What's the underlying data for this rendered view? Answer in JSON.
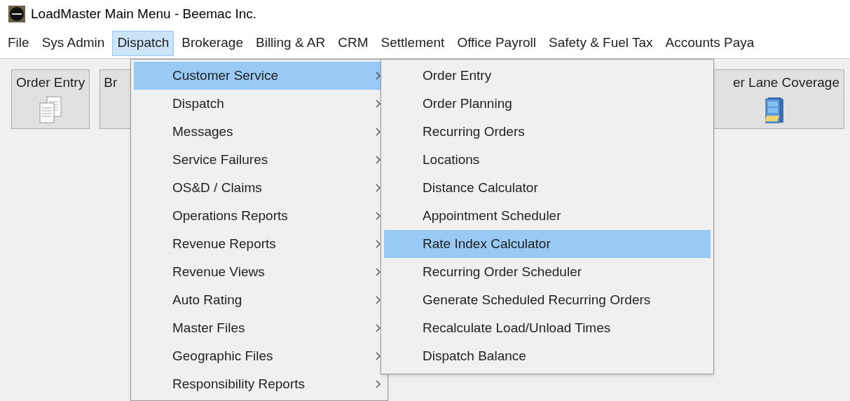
{
  "window": {
    "title": "LoadMaster Main Menu - Beemac Inc."
  },
  "menubar": [
    {
      "label": "File",
      "selected": false
    },
    {
      "label": "Sys Admin",
      "selected": false
    },
    {
      "label": "Dispatch",
      "selected": true
    },
    {
      "label": "Brokerage",
      "selected": false
    },
    {
      "label": "Billing & AR",
      "selected": false
    },
    {
      "label": "CRM",
      "selected": false
    },
    {
      "label": "Settlement",
      "selected": false
    },
    {
      "label": "Office Payroll",
      "selected": false
    },
    {
      "label": "Safety & Fuel Tax",
      "selected": false
    },
    {
      "label": "Accounts Paya",
      "selected": false
    }
  ],
  "toolbar": [
    {
      "label": "Order Entry",
      "kind": "documents"
    },
    {
      "label": "Br",
      "kind": "none"
    },
    {
      "label": "er Lane Coverage",
      "kind": "cabinet"
    }
  ],
  "dispatch_menu": [
    {
      "label": "Customer Service",
      "selected": true
    },
    {
      "label": "Dispatch",
      "selected": false
    },
    {
      "label": "Messages",
      "selected": false
    },
    {
      "label": "Service Failures",
      "selected": false
    },
    {
      "label": "OS&D / Claims",
      "selected": false
    },
    {
      "label": "Operations Reports",
      "selected": false
    },
    {
      "label": "Revenue Reports",
      "selected": false
    },
    {
      "label": "Revenue Views",
      "selected": false
    },
    {
      "label": "Auto Rating",
      "selected": false
    },
    {
      "label": "Master Files",
      "selected": false
    },
    {
      "label": "Geographic Files",
      "selected": false
    },
    {
      "label": "Responsibility Reports",
      "selected": false
    }
  ],
  "customer_service_menu": [
    {
      "label": "Order Entry",
      "selected": false
    },
    {
      "label": "Order Planning",
      "selected": false
    },
    {
      "label": "Recurring Orders",
      "selected": false
    },
    {
      "label": "Locations",
      "selected": false
    },
    {
      "label": "Distance Calculator",
      "selected": false
    },
    {
      "label": "Appointment Scheduler",
      "selected": false
    },
    {
      "label": "Rate Index Calculator",
      "selected": true
    },
    {
      "label": "Recurring Order Scheduler",
      "selected": false
    },
    {
      "label": "Generate Scheduled Recurring Orders",
      "selected": false
    },
    {
      "label": "Recalculate Load/Unload Times",
      "selected": false
    },
    {
      "label": "Dispatch Balance",
      "selected": false
    }
  ]
}
